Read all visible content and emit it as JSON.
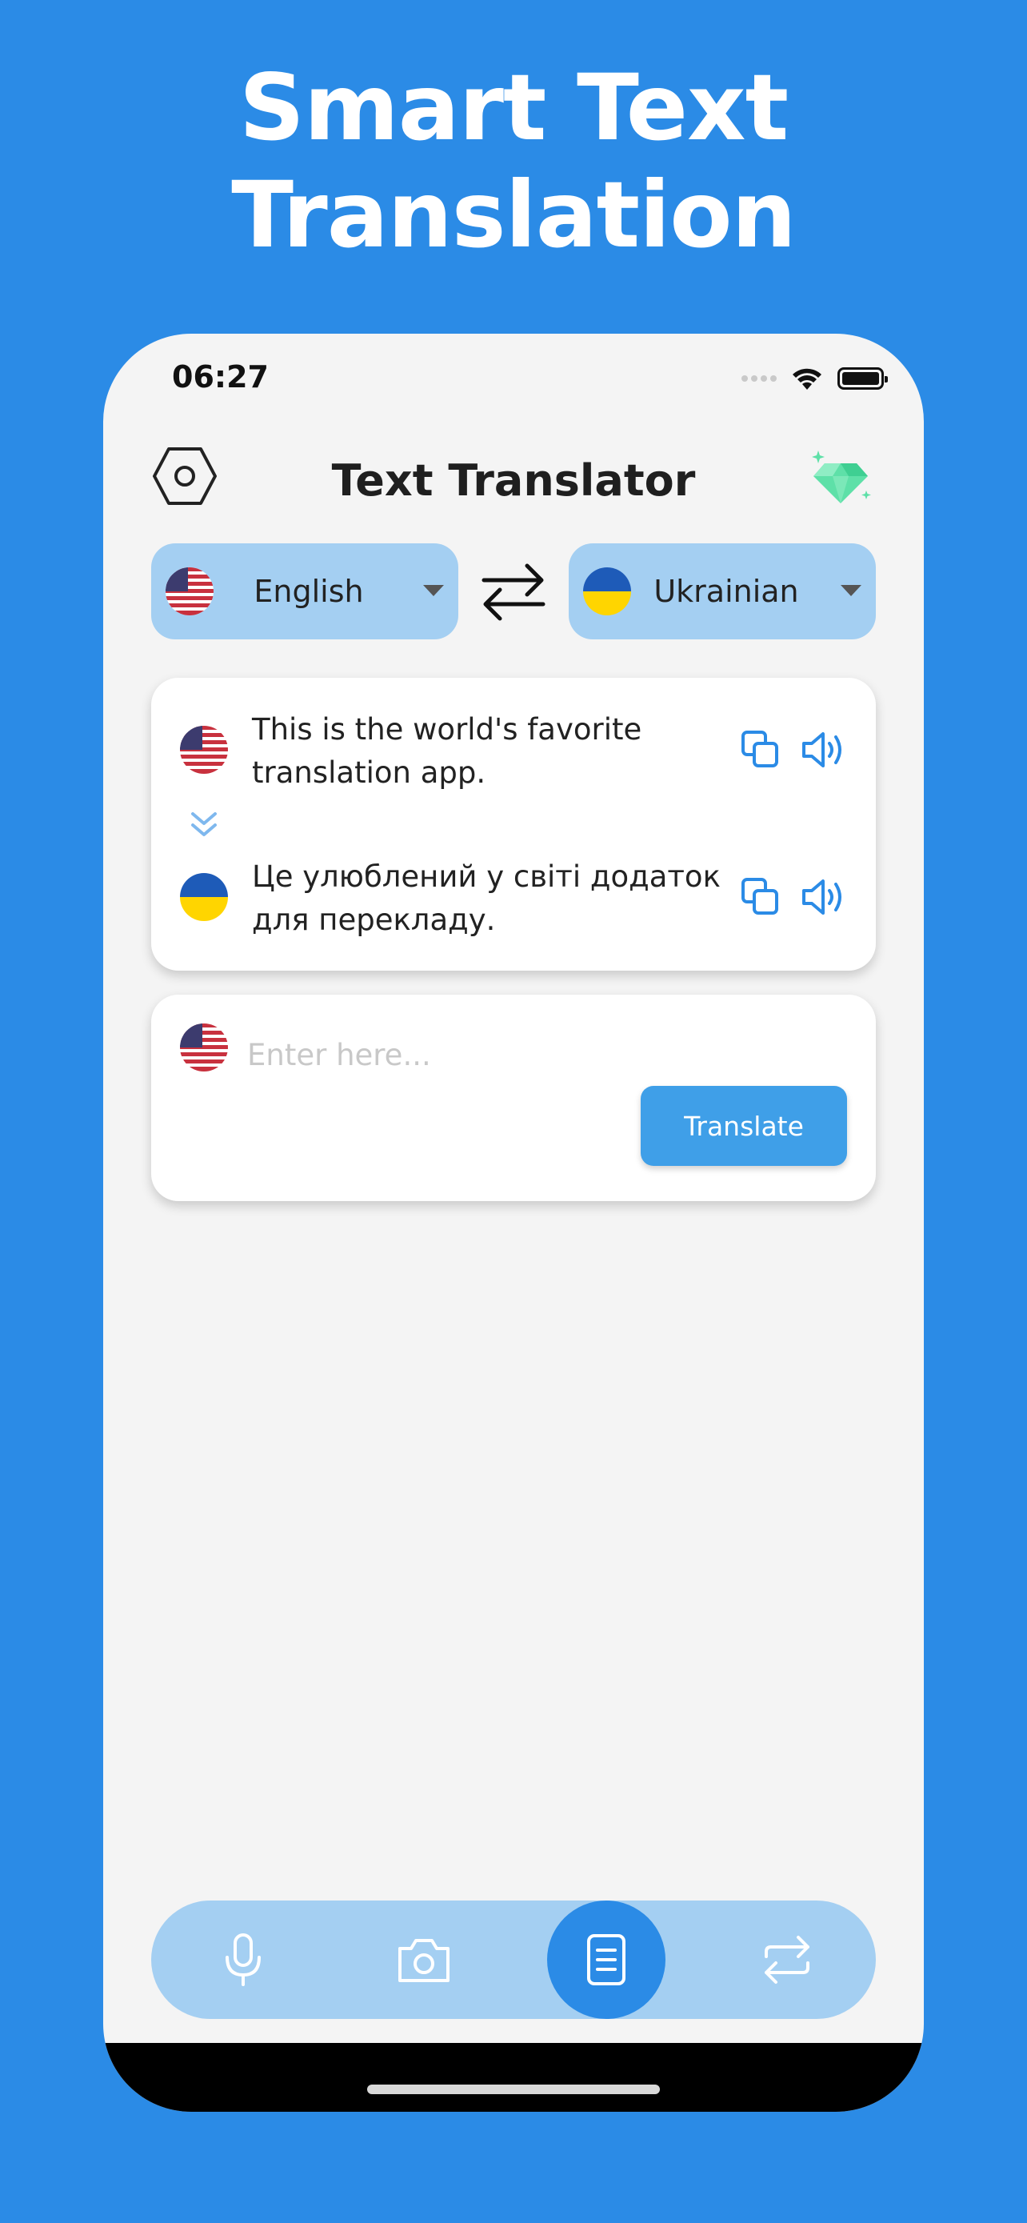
{
  "promo": {
    "headline_line1": "Smart Text",
    "headline_line2": "Translation"
  },
  "status_bar": {
    "time": "06:27"
  },
  "header": {
    "title": "Text Translator",
    "settings_icon": "hexagon-settings-icon",
    "premium_icon": "diamond-icon"
  },
  "languages": {
    "source": {
      "name": "English",
      "flag": "us-flag"
    },
    "target": {
      "name": "Ukrainian",
      "flag": "ukraine-flag"
    },
    "swap_icon": "swap-arrows-icon"
  },
  "result": {
    "source_text": "This is the world's favorite translation app.",
    "translated_text": "Це улюблений у світі додаток для перекладу."
  },
  "input": {
    "placeholder": "Enter here...",
    "value": "",
    "translate_label": "Translate"
  },
  "bottom_nav": {
    "items": [
      {
        "icon": "microphone-icon",
        "active": false
      },
      {
        "icon": "camera-icon",
        "active": false
      },
      {
        "icon": "document-icon",
        "active": true
      },
      {
        "icon": "conversation-swap-icon",
        "active": false
      }
    ]
  },
  "colors": {
    "background": "#2B8BE6",
    "accent": "#2B8BE6",
    "pill": "#A4CFF2",
    "button": "#3F9FE8",
    "premium": "#4BD89C"
  }
}
